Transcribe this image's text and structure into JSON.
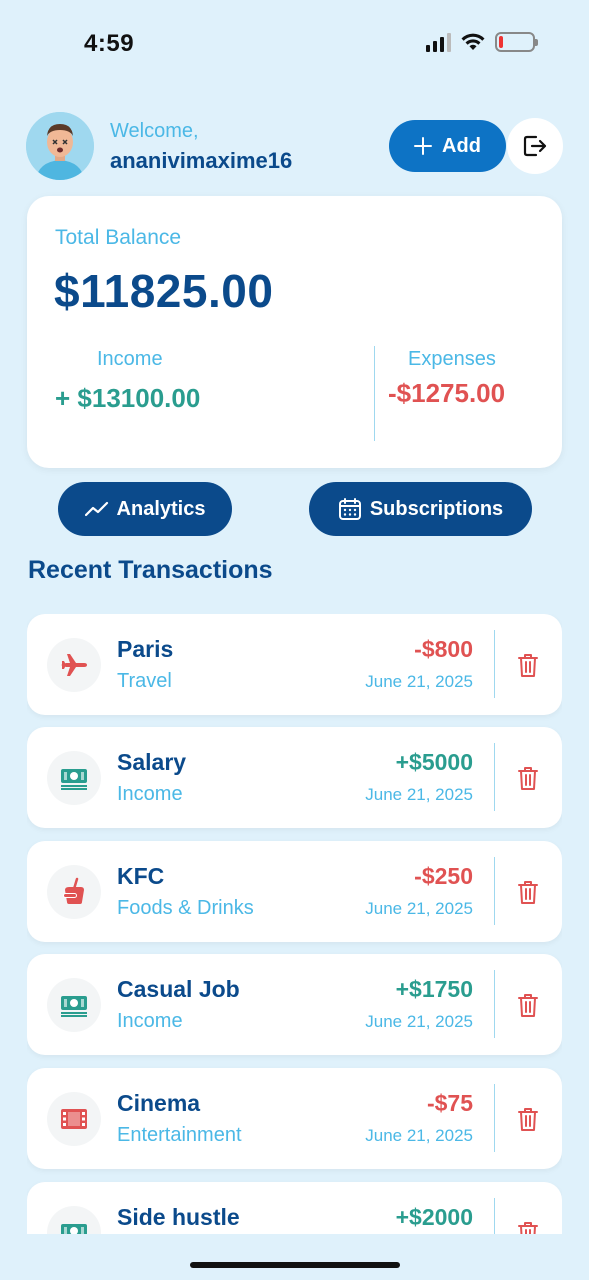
{
  "status_bar": {
    "time": "4:59"
  },
  "header": {
    "welcome": "Welcome,",
    "username": "ananivimaxime16",
    "add_label": "Add"
  },
  "balance": {
    "label": "Total Balance",
    "value": "$11825.00",
    "income_label": "Income",
    "income_value": "+ $13100.00",
    "expenses_label": "Expenses",
    "expenses_value": "-$1275.00"
  },
  "actions": {
    "analytics_label": "Analytics",
    "subscriptions_label": "Subscriptions"
  },
  "recent": {
    "title": "Recent Transactions",
    "items": [
      {
        "name": "Paris",
        "category": "Travel",
        "amount": "-$800",
        "date": "June 21, 2025",
        "icon": "airplane-icon",
        "type": "expense"
      },
      {
        "name": "Salary",
        "category": "Income",
        "amount": "+$5000",
        "date": "June 21, 2025",
        "icon": "cash-icon",
        "type": "income"
      },
      {
        "name": "KFC",
        "category": "Foods & Drinks",
        "amount": "-$250",
        "date": "June 21, 2025",
        "icon": "food-icon",
        "type": "expense"
      },
      {
        "name": "Casual Job",
        "category": "Income",
        "amount": "+$1750",
        "date": "June 21, 2025",
        "icon": "cash-icon",
        "type": "income"
      },
      {
        "name": "Cinema",
        "category": "Entertainment",
        "amount": "-$75",
        "date": "June 21, 2025",
        "icon": "film-icon",
        "type": "expense"
      },
      {
        "name": "Side hustle",
        "category": "",
        "amount": "+$2000",
        "date": "",
        "icon": "cash-icon",
        "type": "income"
      }
    ]
  },
  "colors": {
    "background": "#dff1fb",
    "primary": "#0b4a8b",
    "accent": "#0d73c5",
    "light_blue": "#4bb8e6",
    "income": "#2a9d8f",
    "expense": "#e05252"
  }
}
